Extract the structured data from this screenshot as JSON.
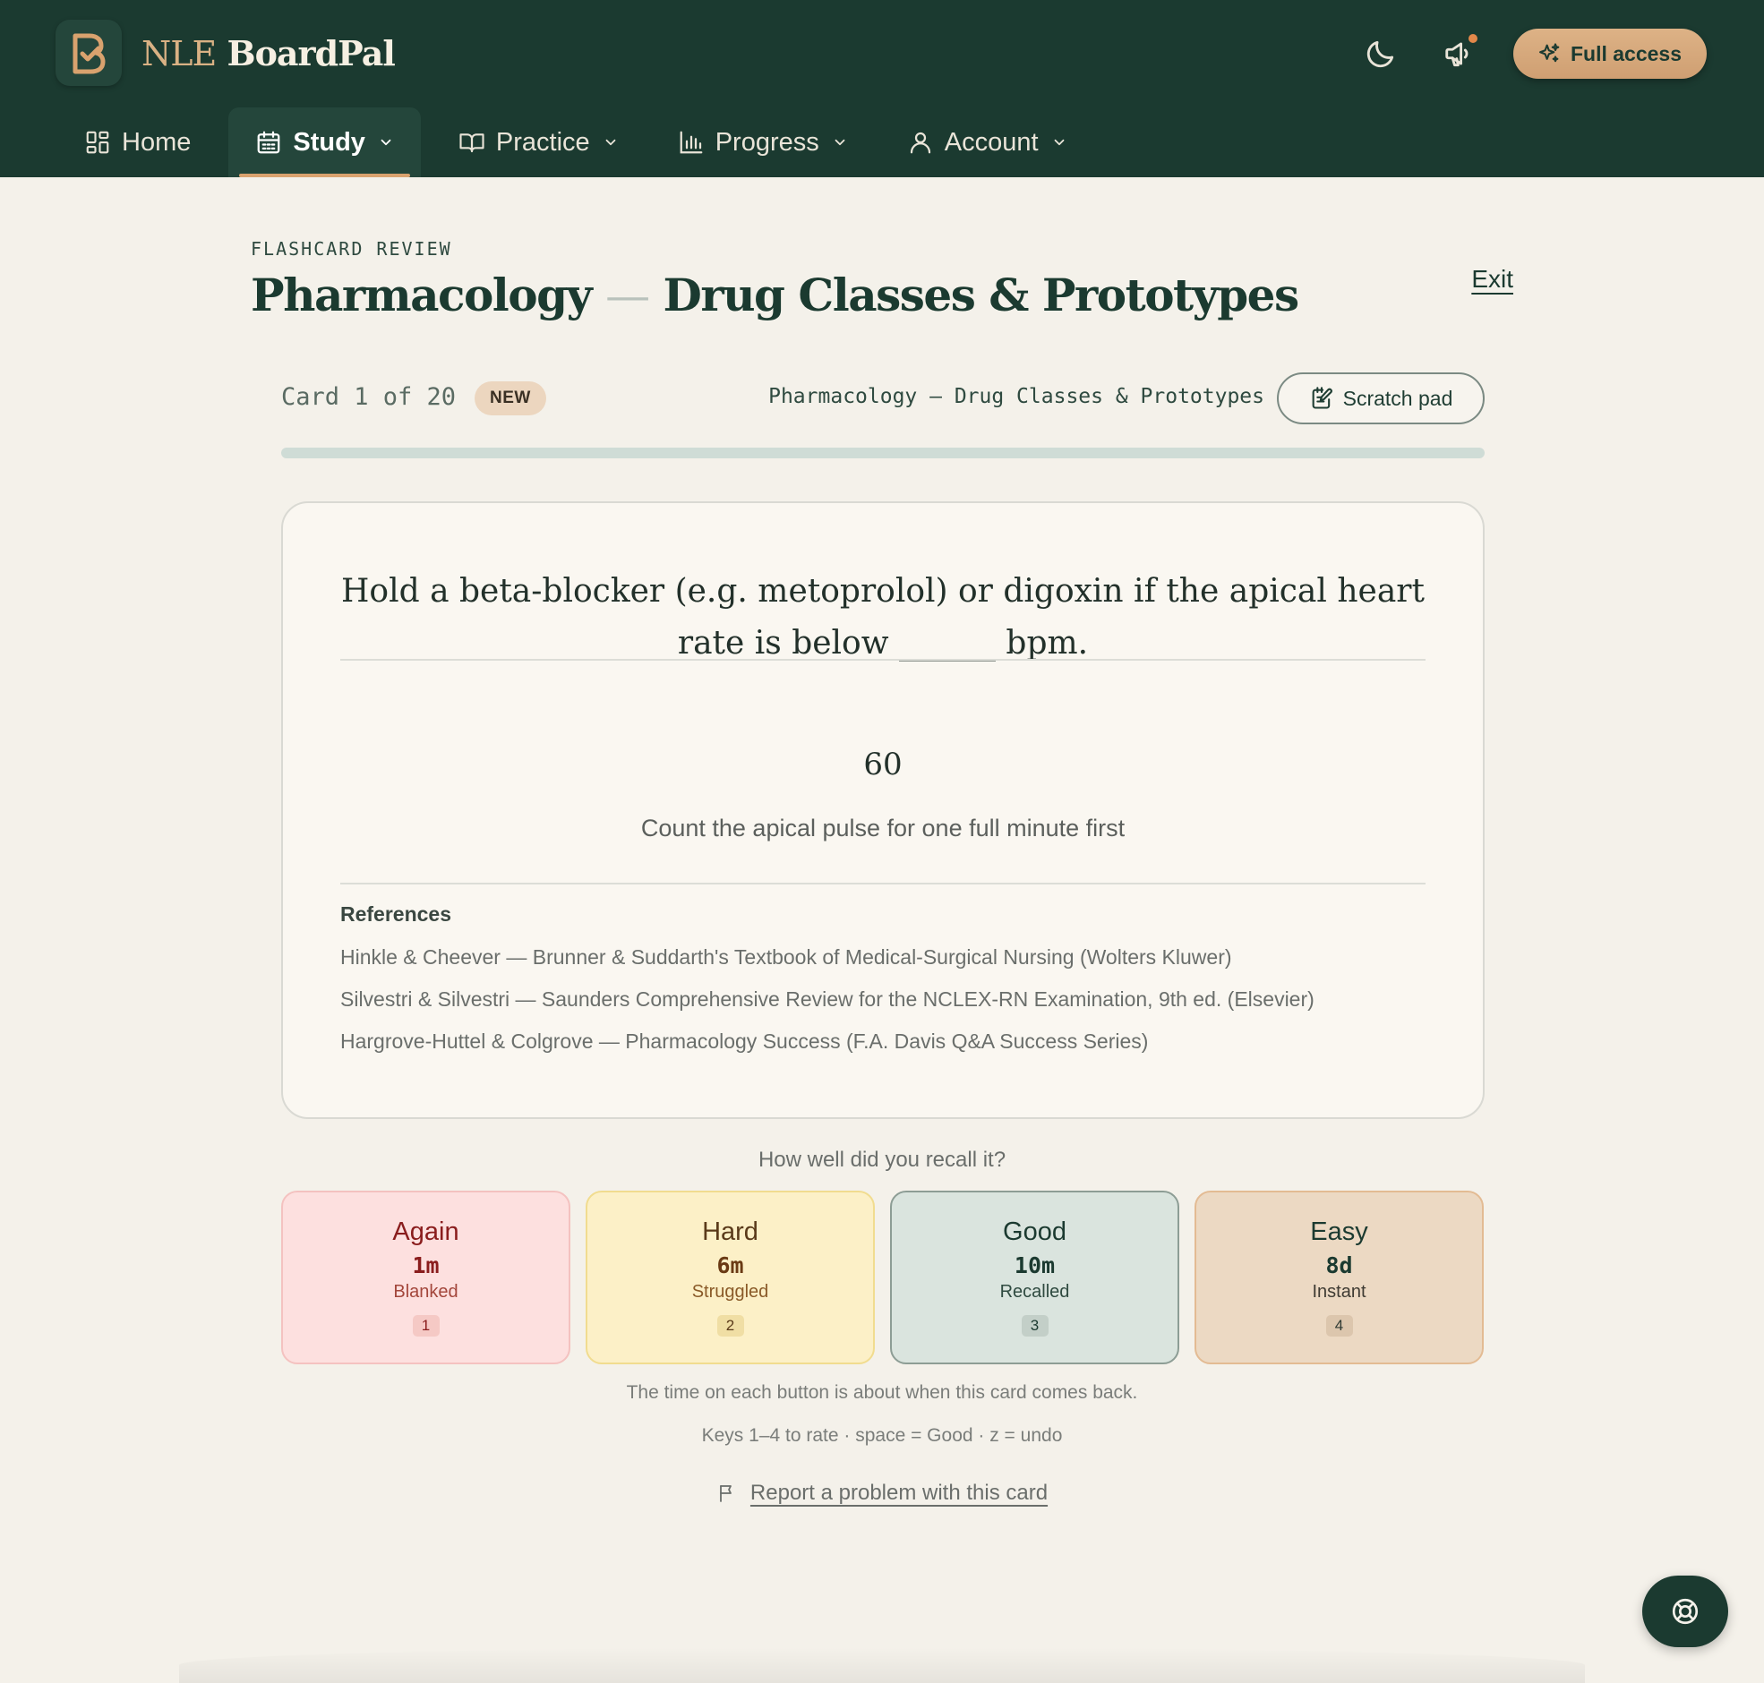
{
  "app": {
    "brand_prefix": "NLE",
    "brand_suffix": "BoardPal",
    "full_access_label": "Full access",
    "icons": {
      "logo": "boardpal-b-logo",
      "theme": "moon-icon",
      "announcements": "megaphone-icon",
      "full_access": "sparkles-icon"
    }
  },
  "nav": {
    "items": [
      {
        "label": "Home",
        "icon": "grid-icon",
        "active": false,
        "dropdown": false
      },
      {
        "label": "Study",
        "icon": "calendar-icon",
        "active": true,
        "dropdown": true
      },
      {
        "label": "Practice",
        "icon": "open-book-icon",
        "active": false,
        "dropdown": true
      },
      {
        "label": "Progress",
        "icon": "bar-chart-icon",
        "active": false,
        "dropdown": true
      },
      {
        "label": "Account",
        "icon": "user-icon",
        "active": false,
        "dropdown": true
      }
    ]
  },
  "page": {
    "eyebrow": "FLASHCARD REVIEW",
    "title_part1": "Pharmacology",
    "title_separator": "—",
    "title_part2": "Drug Classes & Prototypes",
    "exit_label": "Exit"
  },
  "session": {
    "card_counter": "Card 1 of 20",
    "badge": "NEW",
    "deck_name": "Pharmacology — Drug Classes & Prototypes",
    "scratch_pad_label": "Scratch pad",
    "progress_fraction": 0.0
  },
  "card": {
    "question": "Hold a beta-blocker (e.g. metoprolol) or digoxin if the apical heart rate is below ______ bpm.",
    "answer": "60",
    "hint": "Count the apical pulse for one full minute first",
    "references_title": "References",
    "references": [
      "Hinkle & Cheever — Brunner & Suddarth's Textbook of Medical-Surgical Nursing (Wolters Kluwer)",
      "Silvestri & Silvestri — Saunders Comprehensive Review for the NCLEX-RN Examination, 9th ed. (Elsevier)",
      "Hargrove-Huttel & Colgrove — Pharmacology Success (F.A. Davis Q&A Success Series)"
    ]
  },
  "rating": {
    "prompt": "How well did you recall it?",
    "buttons": [
      {
        "label": "Again",
        "time": "1m",
        "desc": "Blanked",
        "key": "1"
      },
      {
        "label": "Hard",
        "time": "6m",
        "desc": "Struggled",
        "key": "2"
      },
      {
        "label": "Good",
        "time": "10m",
        "desc": "Recalled",
        "key": "3"
      },
      {
        "label": "Easy",
        "time": "8d",
        "desc": "Instant",
        "key": "4"
      }
    ],
    "note": "The time on each button is about when this card comes back.",
    "shortcuts": "Keys 1–4 to rate · space = Good · z = undo",
    "report_label": "Report a problem with this card"
  },
  "colors": {
    "header_bg": "#1b3a30",
    "accent": "#d9a26e",
    "page_bg": "#f4f1ea"
  }
}
